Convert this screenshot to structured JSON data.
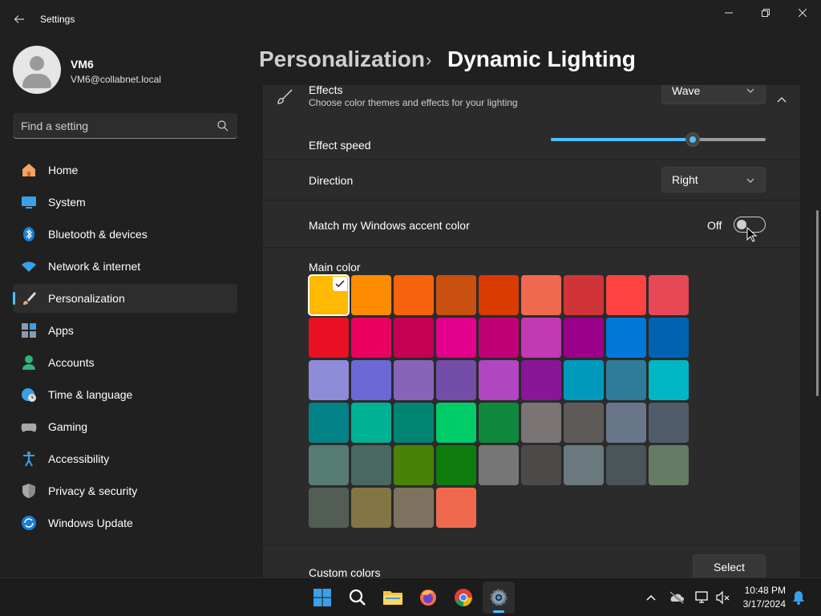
{
  "window": {
    "title": "Settings"
  },
  "profile": {
    "name": "VM6",
    "email": "VM6@collabnet.local"
  },
  "search": {
    "placeholder": "Find a setting"
  },
  "nav": {
    "items": [
      {
        "label": "Home",
        "icon": "home-icon"
      },
      {
        "label": "System",
        "icon": "system-icon"
      },
      {
        "label": "Bluetooth & devices",
        "icon": "bluetooth-icon"
      },
      {
        "label": "Network & internet",
        "icon": "wifi-icon"
      },
      {
        "label": "Personalization",
        "icon": "brush-icon",
        "active": true
      },
      {
        "label": "Apps",
        "icon": "apps-icon"
      },
      {
        "label": "Accounts",
        "icon": "accounts-icon"
      },
      {
        "label": "Time & language",
        "icon": "globe-clock-icon"
      },
      {
        "label": "Gaming",
        "icon": "gamepad-icon"
      },
      {
        "label": "Accessibility",
        "icon": "accessibility-icon"
      },
      {
        "label": "Privacy & security",
        "icon": "shield-icon"
      },
      {
        "label": "Windows Update",
        "icon": "update-icon"
      }
    ]
  },
  "breadcrumb": {
    "parent": "Personalization",
    "separator": "›",
    "current": "Dynamic Lighting"
  },
  "effects": {
    "title": "Effects",
    "description": "Choose color themes and effects for your lighting",
    "value": "Wave"
  },
  "effect_speed": {
    "label": "Effect speed",
    "value": 0.66
  },
  "direction": {
    "label": "Direction",
    "value": "Right"
  },
  "accent": {
    "label": "Match my Windows accent color",
    "state": "Off"
  },
  "main_color": {
    "label": "Main color",
    "selected_index": 0,
    "swatches": [
      "#FFB900",
      "#FF8C00",
      "#F7630C",
      "#CA5010",
      "#DA3B01",
      "#EF6950",
      "#D13438",
      "#FF4343",
      "#E74856",
      "#E81123",
      "#EA005E",
      "#C30052",
      "#E3008C",
      "#BF0077",
      "#C239B3",
      "#9A0089",
      "#0078D7",
      "#0063B1",
      "#8E8CD8",
      "#6B69D6",
      "#8764B8",
      "#744DA9",
      "#B146C2",
      "#881798",
      "#0099BC",
      "#2D7D9A",
      "#00B7C3",
      "#038387",
      "#00B294",
      "#018574",
      "#00CC6A",
      "#10893E",
      "#7A7574",
      "#5D5A58",
      "#68768A",
      "#515C6B",
      "#567C73",
      "#486860",
      "#498205",
      "#107C10",
      "#767676",
      "#4C4A48",
      "#69797E",
      "#4A5459",
      "#647C64",
      "#525E54",
      "#847545",
      "#7E735F",
      "#F0694F"
    ]
  },
  "custom_colors": {
    "label": "Custom colors",
    "button": "Select"
  },
  "taskbar": {
    "apps": [
      "start-icon",
      "search-icon",
      "file-explorer-icon",
      "firefox-icon",
      "chrome-icon",
      "settings-icon"
    ],
    "time": "10:48 PM",
    "date": "3/17/2024"
  },
  "colors": {
    "accent": "#4CC2FF",
    "background": "#202020",
    "card": "#2B2B2B"
  }
}
